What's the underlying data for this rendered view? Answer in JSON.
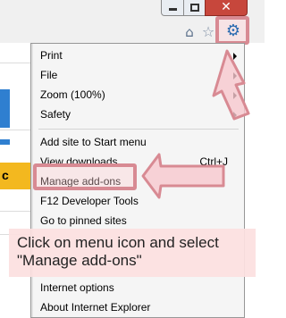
{
  "window": {
    "minimize_icon": "minimize-icon",
    "maximize_icon": "maximize-icon",
    "close_symbol": "✕"
  },
  "toolbar": {
    "home_icon": "⌂",
    "favorites_icon": "☆",
    "tools_icon": "⚙"
  },
  "page": {
    "partial_letter": "c"
  },
  "menu": {
    "print": "Print",
    "file": "File",
    "zoom": "Zoom (100%)",
    "safety": "Safety",
    "add_site": "Add site to Start menu",
    "view_downloads": "View downloads",
    "view_downloads_shortcut": "Ctrl+J",
    "manage_addons": "Manage add-ons",
    "f12_tools": "F12 Developer Tools",
    "pinned_sites": "Go to pinned sites",
    "internet_options": "Internet options",
    "about_ie": "About Internet Explorer"
  },
  "tooltip": {
    "text": "Click on menu icon and select \"Manage add-ons\""
  },
  "colors": {
    "highlight_border": "#d88a93",
    "tooltip_bg": "#fce0e0",
    "gear_blue": "#2a6ab0",
    "close_red": "#c7473c",
    "page_blue": "#2f7fd0",
    "page_yellow": "#f3b81f"
  }
}
